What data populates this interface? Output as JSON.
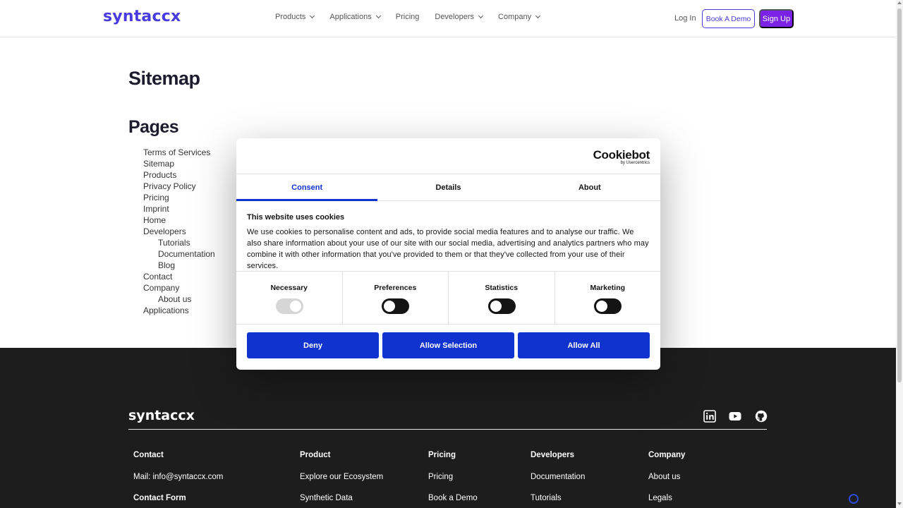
{
  "header": {
    "logo": "syntaccx",
    "nav": [
      {
        "label": "Products",
        "dropdown": true
      },
      {
        "label": "Applications",
        "dropdown": true
      },
      {
        "label": "Pricing",
        "dropdown": false
      },
      {
        "label": "Developers",
        "dropdown": true
      },
      {
        "label": "Company",
        "dropdown": true
      }
    ],
    "login_label": "Log In",
    "demo_label": "Book A Demo",
    "signup_label": "Sign Up"
  },
  "main": {
    "title": "Sitemap",
    "section_title": "Pages",
    "pages": [
      {
        "label": "Terms of Services",
        "sub": false
      },
      {
        "label": "Sitemap",
        "sub": false
      },
      {
        "label": "Products",
        "sub": false
      },
      {
        "label": "Privacy Policy",
        "sub": false
      },
      {
        "label": "Pricing",
        "sub": false
      },
      {
        "label": "Imprint",
        "sub": false
      },
      {
        "label": "Home",
        "sub": false
      },
      {
        "label": "Developers",
        "sub": false
      },
      {
        "label": "Tutorials",
        "sub": true
      },
      {
        "label": "Documentation",
        "sub": true
      },
      {
        "label": "Blog",
        "sub": true
      },
      {
        "label": "Contact",
        "sub": false
      },
      {
        "label": "Company",
        "sub": false
      },
      {
        "label": "About us",
        "sub": true
      },
      {
        "label": "Applications",
        "sub": false
      }
    ]
  },
  "cookie_dialog": {
    "brand": "Cookiebot",
    "brand_by": "by Usercentrics",
    "tabs": [
      {
        "label": "Consent",
        "active": true
      },
      {
        "label": "Details",
        "active": false
      },
      {
        "label": "About",
        "active": false
      }
    ],
    "title": "This website uses cookies",
    "text": "We use cookies to personalise content and ads, to provide social media features and to analyse our traffic. We also share information about your use of our site with our social media, advertising and analytics partners who may combine it with other information that you've provided to them or that they've collected from your use of their services.",
    "categories": [
      {
        "label": "Necessary",
        "checked": true,
        "disabled": true
      },
      {
        "label": "Preferences",
        "checked": false,
        "disabled": false
      },
      {
        "label": "Statistics",
        "checked": false,
        "disabled": false
      },
      {
        "label": "Marketing",
        "checked": false,
        "disabled": false
      }
    ],
    "buttons": {
      "deny": "Deny",
      "allow_selection": "Allow Selection",
      "allow_all": "Allow All"
    }
  },
  "footer": {
    "logo": "syntaccx",
    "social_icons": [
      "linkedin-icon",
      "youtube-icon",
      "github-icon"
    ],
    "columns": [
      {
        "title": "Contact",
        "links": [
          {
            "label": "Mail: info@syntaccx.com",
            "bold": false
          },
          {
            "label": "Contact Form",
            "bold": true
          }
        ]
      },
      {
        "title": "Product",
        "links": [
          {
            "label": "Explore our Ecosystem",
            "bold": false
          },
          {
            "label": "Synthetic Data",
            "bold": false
          }
        ]
      },
      {
        "title": "Pricing",
        "links": [
          {
            "label": "Pricing",
            "bold": false
          },
          {
            "label": "Book a Demo",
            "bold": false
          }
        ]
      },
      {
        "title": "Developers",
        "links": [
          {
            "label": "Documentation",
            "bold": false
          },
          {
            "label": "Tutorials",
            "bold": false
          }
        ]
      },
      {
        "title": "Company",
        "links": [
          {
            "label": "About us",
            "bold": false
          },
          {
            "label": "Legals",
            "bold": false
          }
        ]
      }
    ]
  },
  "colors": {
    "brand": "#4a3be0",
    "signup": "#7a22e6",
    "cookie_primary": "#1032cf",
    "footer_bg": "#1d1d1d"
  }
}
